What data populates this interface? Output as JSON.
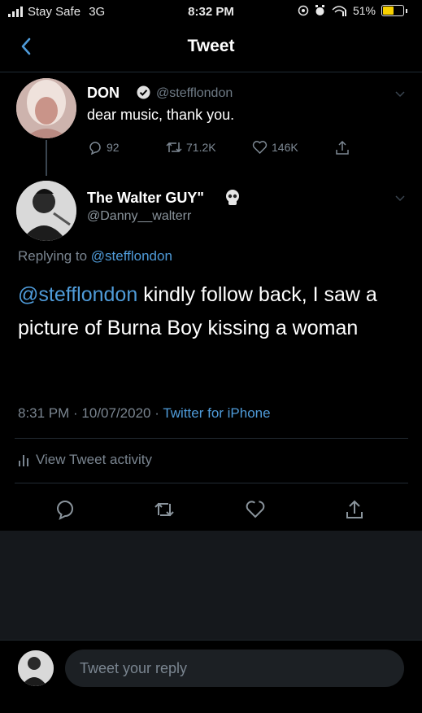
{
  "status_bar": {
    "carrier": "Stay Safe",
    "network": "3G",
    "time": "8:32 PM",
    "battery_percent": "51%",
    "battery_color": "#f7d000"
  },
  "header": {
    "title": "Tweet",
    "back_icon": "chevron-left-icon"
  },
  "original_tweet": {
    "name": "DON",
    "handle": "@stefflondon",
    "text": "dear music, thank you.",
    "replies": "92",
    "retweets": "71.2K",
    "likes": "146K"
  },
  "reply_tweet": {
    "name": "The Walter GUY\"",
    "handle": "@Danny__walterr",
    "replying_label": "Replying to",
    "replying_to": "@stefflondon",
    "mention": "@stefflondon",
    "text": " kindly follow back, I saw a picture of Burna Boy kissing a woman",
    "time": "8:31 PM · 10/07/2020 · ",
    "source": "Twitter for iPhone",
    "activity_label": "View Tweet activity"
  },
  "composer": {
    "placeholder": "Tweet your reply"
  },
  "colors": {
    "link": "#4f9bd9",
    "muted": "#7a8590",
    "background": "#000000"
  }
}
